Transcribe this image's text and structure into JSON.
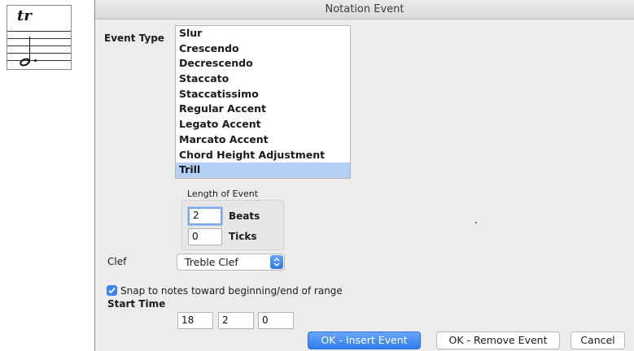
{
  "staff_snippet": {
    "ornament": "tr"
  },
  "dialog": {
    "title": "Notation Event",
    "event_type_label": "Event Type",
    "event_types": [
      "Slur",
      "Crescendo",
      "Decrescendo",
      "Staccato",
      "Staccatissimo",
      "Regular Accent",
      "Legato Accent",
      "Marcato Accent",
      "Chord Height Adjustment",
      "Trill"
    ],
    "selected_event_type": "Trill",
    "length": {
      "group_title": "Length of Event",
      "beats_value": "2",
      "beats_label": "Beats",
      "ticks_value": "0",
      "ticks_label": "Ticks"
    },
    "clef": {
      "label": "Clef",
      "selected": "Treble Clef"
    },
    "snap": {
      "label": "Snap to notes toward beginning/end of range",
      "checked": true
    },
    "start_time": {
      "label": "Start Time",
      "bar": "18",
      "beat": "2",
      "tick": "0"
    },
    "buttons": {
      "insert": "OK - Insert Event",
      "remove": "OK - Remove Event",
      "cancel": "Cancel"
    },
    "colors": {
      "accent": "#2f7cf0",
      "selection": "#b5d0f5"
    }
  }
}
